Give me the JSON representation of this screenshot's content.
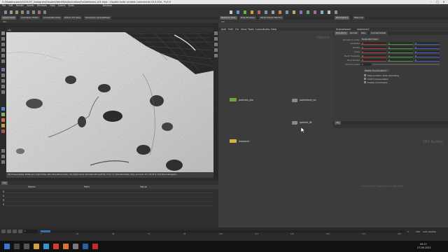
{
  "window": {
    "title": "C:/Shaders/work/2025/07_Instagram/Houdini/Workfiles/Animation/Full/deferred_v01.hiplc - Houdini Indie Limited-Commercial 19.5.534 - Py3.9"
  },
  "menus": [
    "File",
    "Edit",
    "Render",
    "Assets",
    "Windows",
    "Help",
    "Solaris",
    "Build",
    "Desktop"
  ],
  "viewport": {
    "tabs": [
      "Scene View",
      "Animation Editor",
      "Composite View",
      "Motion FX View",
      "Geometry Spreadsheet"
    ],
    "path_label": "obj",
    "status_text": "left mouse tumbles. Middle pans. Right dollies. Ctrl+Alt+Left box-zooms. Ctrl+Right zooms. Spacebar+Ctrl+Left tilts. Hold L for alternate tumble, dolly, and zoom. M or Alt+M for First Person Navigation."
  },
  "network": {
    "tabs": [
      "Network View",
      "Help Browser",
      "Performance Monitor"
    ],
    "menu": [
      "Add",
      "Edit",
      "Go",
      "View",
      "Tools",
      "Layout",
      "Labs",
      "Help"
    ],
    "path": "obj",
    "context_label": "Objects",
    "nodes": [
      {
        "name": "particles_sim",
        "color": "#6da542"
      },
      {
        "name": "particlesim_src",
        "color": "#8a8a8a"
      },
      {
        "name": "particle_fill",
        "color": "#8a8a8a"
      },
      {
        "name": "instance1",
        "color": "#d6b23c"
      }
    ]
  },
  "params": {
    "tabs": [
      "Parameters",
      "Take List"
    ],
    "node_label": "Subnetwork",
    "node_name": "instance1",
    "subtabs": [
      "Transform",
      "Render",
      "Misc",
      "Subnet/Global"
    ],
    "fields": [
      {
        "label": "Transform Order",
        "value": "Scale Rot Trans"
      },
      {
        "label": "Translate",
        "value": "0"
      },
      {
        "label": "Rotate",
        "value": "0"
      },
      {
        "label": "Scale",
        "value": "1"
      },
      {
        "label": "Pivot Translate",
        "value": "0"
      },
      {
        "label": "Pivot Rotate",
        "value": "0"
      },
      {
        "label": "Uniform Scale",
        "value": "1"
      }
    ],
    "dropdown": "Modify Pre-Transform",
    "checkboxes": [
      "Keep position when parenting",
      "Child Compensation",
      "Enable Constraints"
    ]
  },
  "vex": {
    "path": "obj",
    "title": "VEX Builder",
    "hint": "Press Tab or Right-click to Add Node"
  },
  "channels": {
    "label": "obj",
    "header": [
      "Name",
      "Path",
      "Value"
    ],
    "rows": [
      "0",
      "0",
      "0",
      "0"
    ]
  },
  "timeline": {
    "frame": "1",
    "start": "1",
    "end": "240",
    "fps": "24",
    "ticks": [
      "1",
      "24",
      "48",
      "72",
      "96",
      "120",
      "144",
      "168",
      "192",
      "216",
      "240"
    ],
    "auto_update": "Auto Update"
  },
  "taskbar": {
    "time": "09:27",
    "date": "27.06.2023"
  }
}
